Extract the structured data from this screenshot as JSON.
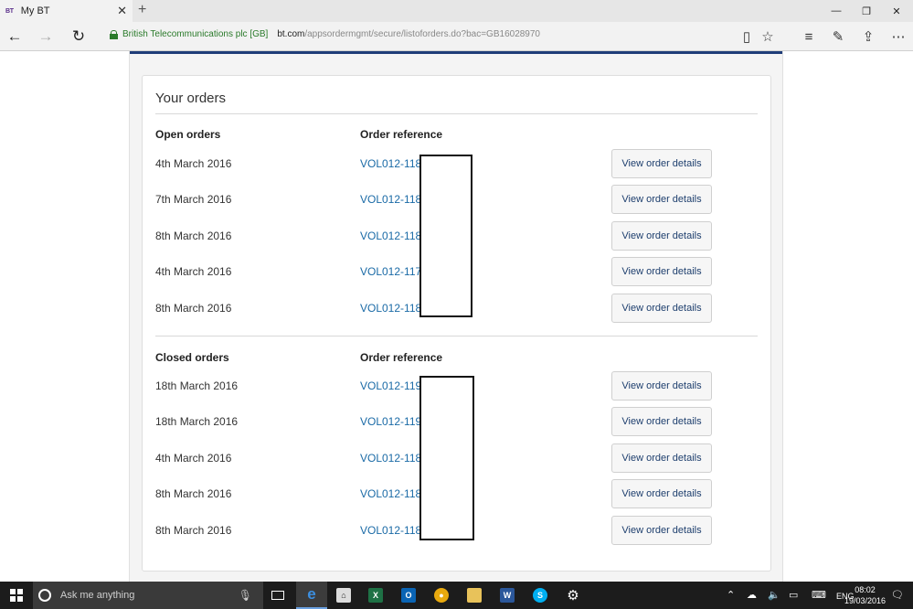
{
  "browser": {
    "tab_title": "My BT",
    "tab_favicon": "BT",
    "secure_label": "British Telecommunications plc [GB]",
    "url_host": "bt.com",
    "url_path": "/appsordermgmt/secure/listoforders.do?bac=GB16028970"
  },
  "page": {
    "title": "Your orders",
    "open_section": {
      "heading": "Open orders",
      "ref_heading": "Order reference",
      "rows": [
        {
          "date": "4th March 2016",
          "ref": "VOL012-118",
          "button": "View order details"
        },
        {
          "date": "7th March 2016",
          "ref": "VOL012-118",
          "button": "View order details"
        },
        {
          "date": "8th March 2016",
          "ref": "VOL012-118",
          "button": "View order details"
        },
        {
          "date": "4th March 2016",
          "ref": "VOL012-117",
          "button": "View order details"
        },
        {
          "date": "8th March 2016",
          "ref": "VOL012-118",
          "button": "View order details"
        }
      ]
    },
    "closed_section": {
      "heading": "Closed orders",
      "ref_heading": "Order reference",
      "rows": [
        {
          "date": "18th March 2016",
          "ref": "VOL012-119",
          "button": "View order details"
        },
        {
          "date": "18th March 2016",
          "ref": "VOL012-119",
          "button": "View order details"
        },
        {
          "date": "4th March 2016",
          "ref": "VOL012-118",
          "button": "View order details"
        },
        {
          "date": "8th March 2016",
          "ref": "VOL012-118",
          "button": "View order details"
        },
        {
          "date": "8th March 2016",
          "ref": "VOL012-118",
          "button": "View order details"
        }
      ]
    }
  },
  "taskbar": {
    "search_placeholder": "Ask me anything",
    "language": "ENG",
    "time": "08:02",
    "date": "19/03/2016"
  },
  "colors": {
    "link": "#1a6aa6",
    "brand_bar": "#1f3d78",
    "secure_green": "#2a7a2a"
  }
}
